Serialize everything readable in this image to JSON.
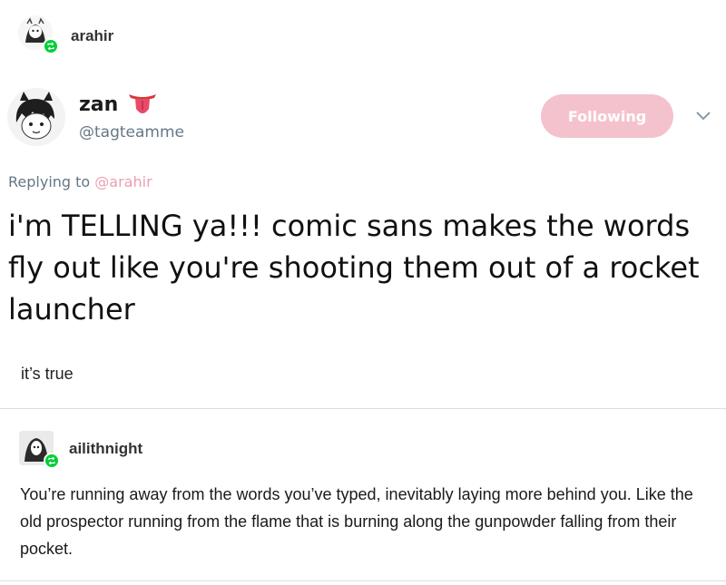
{
  "post": {
    "author": "arahir",
    "badge_icon": "reblog-icon"
  },
  "tweet": {
    "name": "zan",
    "emoji_icon": "tongue-icon",
    "handle": "@tagteamme",
    "follow_label": "Following",
    "follow_color": "#f4c2cd",
    "menu_icon": "chevron-down-icon",
    "replying_prefix": "Replying to ",
    "replying_mention": "@arahir",
    "text": "i'm TELLING ya!!! comic sans makes the words fly out like you're shooting them out of a rocket launcher"
  },
  "caption": "it’s true",
  "reply": {
    "author": "ailithnight",
    "text": "You’re running away from the words you’ve typed, inevitably laying more behind you. Like the old prospector running from the flame that is burning along the gunpowder falling from their pocket."
  },
  "colors": {
    "reblog_green": "#00cf35",
    "handle_gray": "#657786",
    "mention_pink": "#e9a0b2"
  }
}
